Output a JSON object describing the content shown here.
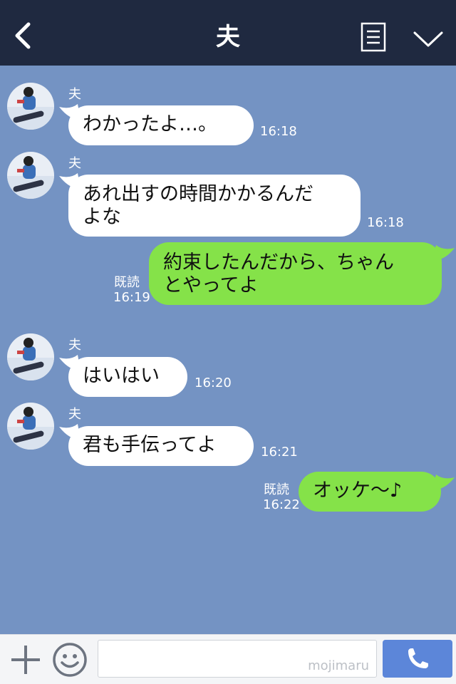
{
  "header": {
    "title": "夫"
  },
  "messages": [
    {
      "side": "in",
      "sender": "夫",
      "lines": [
        "わかったよ…。"
      ],
      "time": "16:18"
    },
    {
      "side": "in",
      "sender": "夫",
      "lines": [
        "あれ出すの時間かかるんだ",
        "よな"
      ],
      "time": "16:18"
    },
    {
      "side": "out",
      "read": "既読",
      "lines": [
        "約束したんだから、ちゃん",
        "とやってよ"
      ],
      "time": "16:19"
    },
    {
      "side": "in",
      "sender": "夫",
      "lines": [
        "はいはい"
      ],
      "time": "16:20"
    },
    {
      "side": "in",
      "sender": "夫",
      "lines": [
        "君も手伝ってよ"
      ],
      "time": "16:21"
    },
    {
      "side": "out",
      "read": "既読",
      "lines": [
        "オッケ〜♪"
      ],
      "time": "16:22"
    }
  ],
  "input": {
    "watermark": "mojimaru"
  },
  "colors": {
    "header": "#1f2940",
    "chat_bg": "#7493c3",
    "outgoing_bubble": "#85e249",
    "incoming_bubble": "#ffffff",
    "call_button": "#5c86d9"
  },
  "icons": [
    "back-icon",
    "notes-icon",
    "chevron-down-icon",
    "plus-icon",
    "emoji-icon",
    "phone-icon"
  ]
}
